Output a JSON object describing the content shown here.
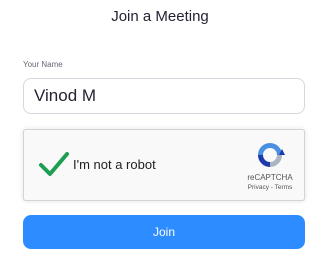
{
  "dialog": {
    "title": "Join a Meeting"
  },
  "name_field": {
    "label": "Your Name",
    "value": "Vinod M"
  },
  "captcha": {
    "label": "I'm not a robot",
    "checked": true,
    "brand": "reCAPTCHA",
    "privacy_link": "Privacy",
    "separator": "-",
    "terms_link": "Terms",
    "check_color": "#1e9e52",
    "logo_icon": "recaptcha-logo-icon"
  },
  "join_button": {
    "label": "Join",
    "color": "#2d8cff"
  }
}
